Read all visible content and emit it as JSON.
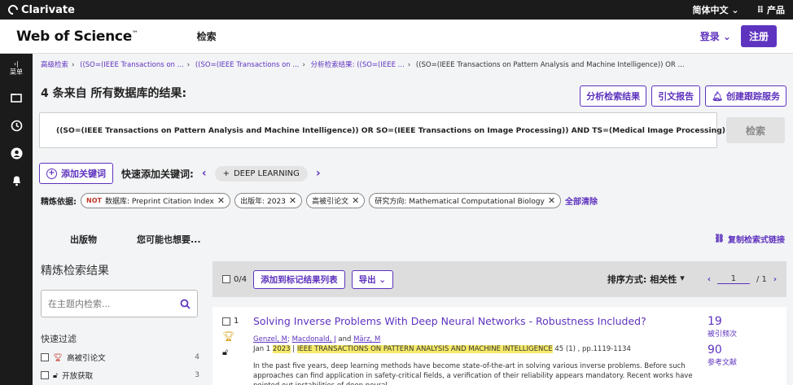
{
  "topbar": {
    "brand": "Clarivate",
    "language": "简体中文",
    "products": "产品"
  },
  "header": {
    "logo": "Web of Science",
    "logo_tm": "™",
    "nav_search": "检索",
    "login": "登录",
    "register": "注册"
  },
  "sidebar": {
    "menu_label": "菜单"
  },
  "breadcrumb": [
    "高级检索",
    "((SO=(IEEE Transactions on ...",
    "((SO=(IEEE Transactions on ...",
    "分析检索结果: ((SO=(IEEE ...",
    "((SO=(IEEE Transactions on Pattern Analysis and Machine Intelligence)) OR ..."
  ],
  "results": {
    "title": "4 条来自 所有数据库的结果:",
    "analyze_button": "分析检索结果",
    "citation_report_button": "引文报告",
    "create_alert_button": "创建跟踪服务"
  },
  "query": {
    "text": "((SO=(IEEE Transactions on Pattern Analysis and Machine Intelligence)) OR SO=(IEEE Transactions on Image Processing)) AND TS=(Medical Image Processing)",
    "search_button": "检索"
  },
  "keywords": {
    "add_button": "添加关键词",
    "quick_add_label": "快速添加关键词:",
    "chip": "DEEP LEARNING"
  },
  "refine": {
    "label": "精炼依据:",
    "chips": [
      {
        "not": "NOT",
        "text": "数据库: Preprint Citation Index"
      },
      {
        "not": "",
        "text": "出版年: 2023"
      },
      {
        "not": "",
        "text": "高被引论文"
      },
      {
        "not": "",
        "text": "研究方向: Mathematical Computational Biology"
      }
    ],
    "clear_all": "全部清除"
  },
  "tabs": {
    "publications": "出版物",
    "you_may_like": "您可能也想要...",
    "copy_link": "复制检索式链接"
  },
  "refine_panel": {
    "title": "精炼检索结果",
    "search_placeholder": "在主题内检索...",
    "quick_filter_title": "快速过滤",
    "items": [
      {
        "label": "高被引论文",
        "count": "4"
      },
      {
        "label": "开放获取",
        "count": "3"
      }
    ]
  },
  "toolbar": {
    "selected": "0/4",
    "add_to_marked": "添加到标记结果列表",
    "export": "导出",
    "sort_label": "排序方式:",
    "sort_value": "相关性",
    "page": "1",
    "page_total": "/ 1"
  },
  "record": {
    "index": "1",
    "title": "Solving Inverse Problems With Deep Neural Networks - Robustness Included?",
    "author1": "Genzel, M",
    "author2": "Macdonald, J",
    "and": "and",
    "author3": "März, M",
    "date_prefix": "Jan 1",
    "year": "2023",
    "sep": "|",
    "journal": "IEEE TRANSACTIONS ON PATTERN ANALYSIS AND MACHINE INTELLIGENCE",
    "volume": "45 (1) , pp.1119-1134",
    "abstract": "In the past five years, deep learning methods have become state-of-the-art in solving various inverse problems. Before such approaches can find application in safety-critical fields, a verification of their reliability appears mandatory. Recent works have pointed out instabilities of deep neural",
    "citations": "19",
    "citations_label": "被引频次",
    "references": "90",
    "references_label": "参考文献"
  }
}
